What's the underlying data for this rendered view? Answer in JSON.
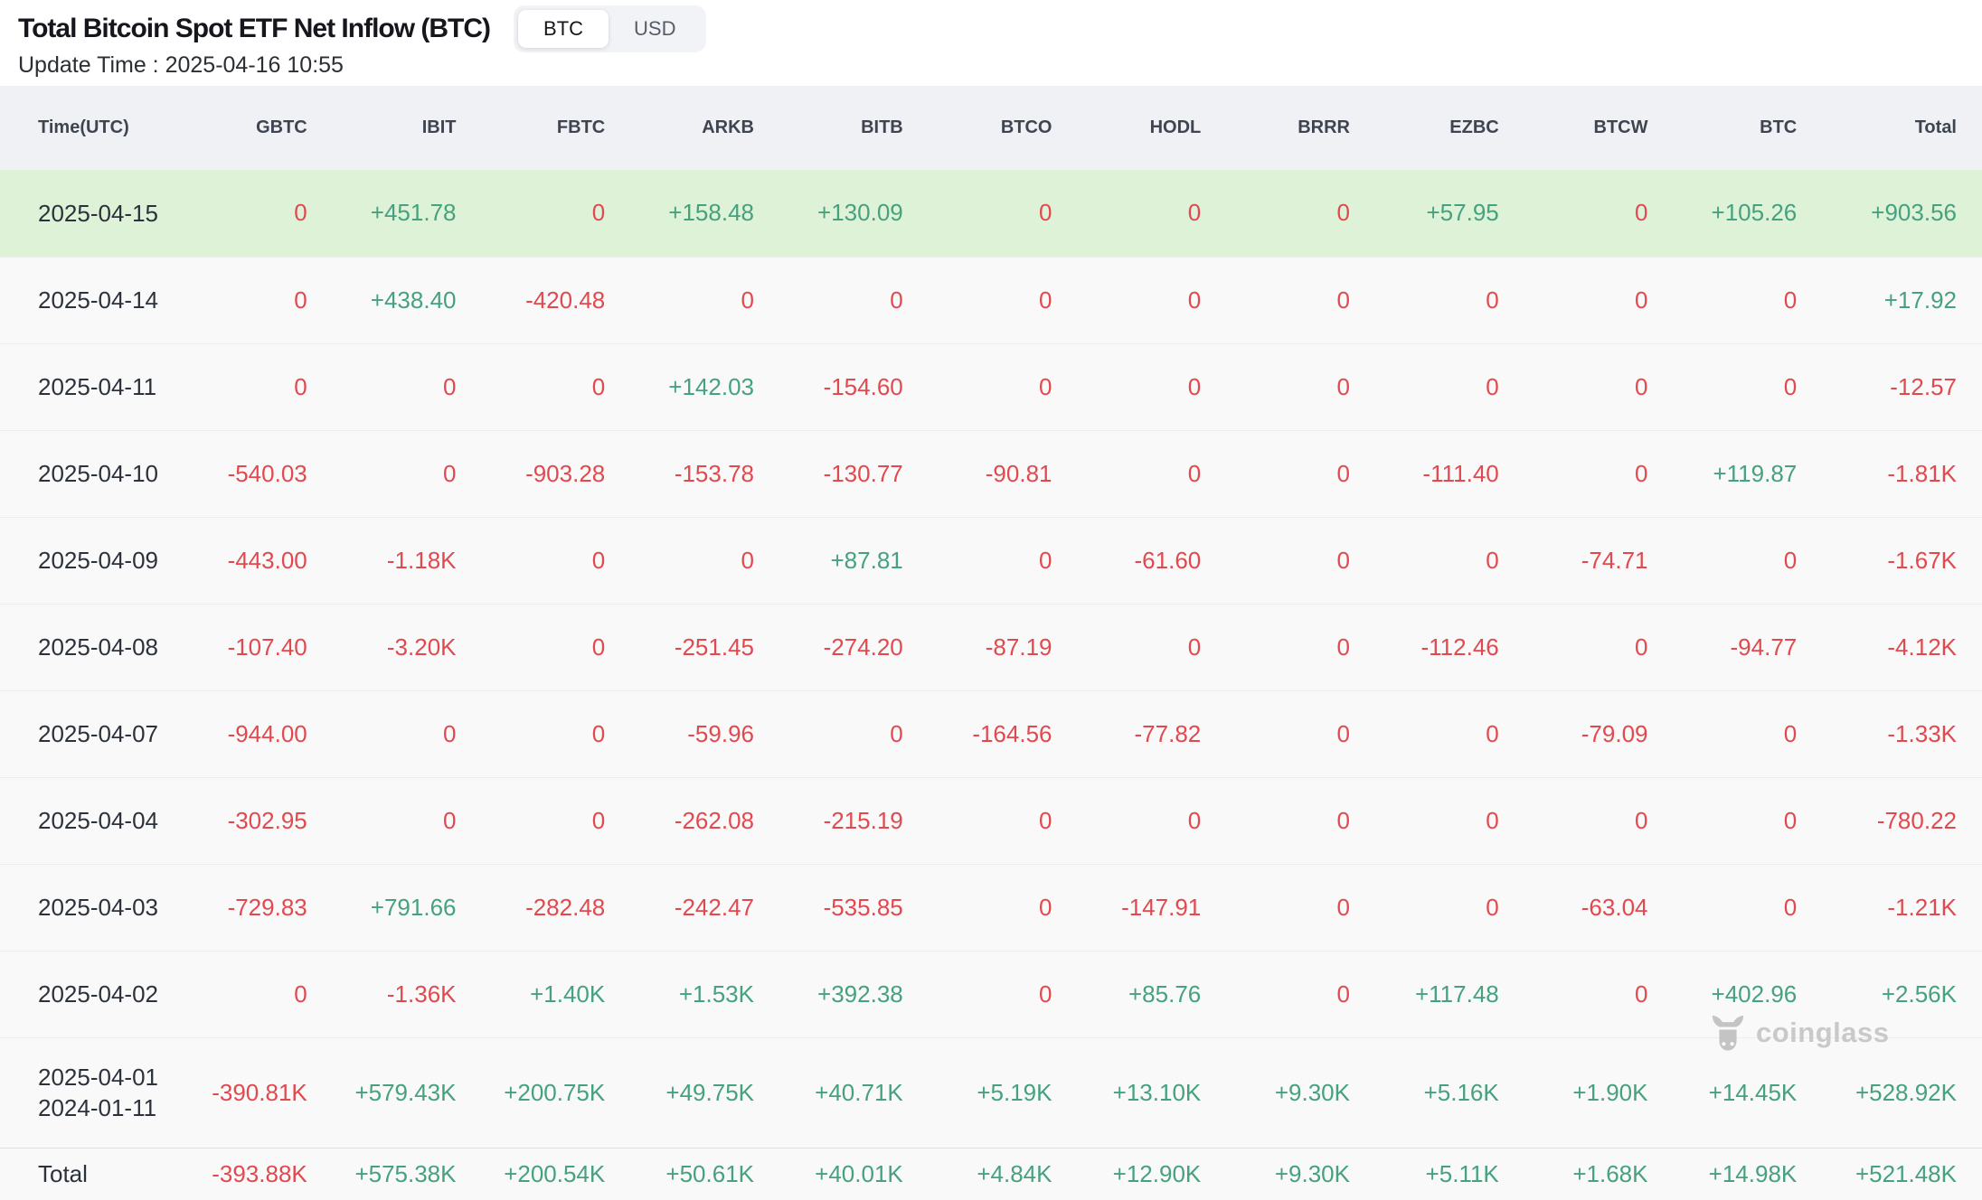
{
  "header": {
    "title": "Total Bitcoin Spot ETF Net Inflow (BTC)",
    "toggle": {
      "options": [
        "BTC",
        "USD"
      ],
      "selected": "BTC"
    },
    "update_time": "Update Time : 2025-04-16 10:55"
  },
  "colors": {
    "positive": "#45a17e",
    "negative": "#e2494f",
    "header_bg": "#f0f1f5",
    "row_bg": "#f9f9f9",
    "highlight_row_bg": "#def2d8"
  },
  "watermark": {
    "icon": "coinglass-bull-icon",
    "text": "coinglass"
  },
  "table": {
    "columns": [
      "Time(UTC)",
      "GBTC",
      "IBIT",
      "FBTC",
      "ARKB",
      "BITB",
      "BTCO",
      "HODL",
      "BRRR",
      "EZBC",
      "BTCW",
      "BTC",
      "Total"
    ],
    "rows": [
      {
        "time": [
          "2025-04-15"
        ],
        "highlight": true,
        "values": [
          "0",
          "+451.78",
          "0",
          "+158.48",
          "+130.09",
          "0",
          "0",
          "0",
          "+57.95",
          "0",
          "+105.26",
          "+903.56"
        ]
      },
      {
        "time": [
          "2025-04-14"
        ],
        "values": [
          "0",
          "+438.40",
          "-420.48",
          "0",
          "0",
          "0",
          "0",
          "0",
          "0",
          "0",
          "0",
          "+17.92"
        ]
      },
      {
        "time": [
          "2025-04-11"
        ],
        "values": [
          "0",
          "0",
          "0",
          "+142.03",
          "-154.60",
          "0",
          "0",
          "0",
          "0",
          "0",
          "0",
          "-12.57"
        ]
      },
      {
        "time": [
          "2025-04-10"
        ],
        "values": [
          "-540.03",
          "0",
          "-903.28",
          "-153.78",
          "-130.77",
          "-90.81",
          "0",
          "0",
          "-111.40",
          "0",
          "+119.87",
          "-1.81K"
        ]
      },
      {
        "time": [
          "2025-04-09"
        ],
        "values": [
          "-443.00",
          "-1.18K",
          "0",
          "0",
          "+87.81",
          "0",
          "-61.60",
          "0",
          "0",
          "-74.71",
          "0",
          "-1.67K"
        ]
      },
      {
        "time": [
          "2025-04-08"
        ],
        "values": [
          "-107.40",
          "-3.20K",
          "0",
          "-251.45",
          "-274.20",
          "-87.19",
          "0",
          "0",
          "-112.46",
          "0",
          "-94.77",
          "-4.12K"
        ]
      },
      {
        "time": [
          "2025-04-07"
        ],
        "values": [
          "-944.00",
          "0",
          "0",
          "-59.96",
          "0",
          "-164.56",
          "-77.82",
          "0",
          "0",
          "-79.09",
          "0",
          "-1.33K"
        ]
      },
      {
        "time": [
          "2025-04-04"
        ],
        "values": [
          "-302.95",
          "0",
          "0",
          "-262.08",
          "-215.19",
          "0",
          "0",
          "0",
          "0",
          "0",
          "0",
          "-780.22"
        ]
      },
      {
        "time": [
          "2025-04-03"
        ],
        "values": [
          "-729.83",
          "+791.66",
          "-282.48",
          "-242.47",
          "-535.85",
          "0",
          "-147.91",
          "0",
          "0",
          "-63.04",
          "0",
          "-1.21K"
        ]
      },
      {
        "time": [
          "2025-04-02"
        ],
        "values": [
          "0",
          "-1.36K",
          "+1.40K",
          "+1.53K",
          "+392.38",
          "0",
          "+85.76",
          "0",
          "+117.48",
          "0",
          "+402.96",
          "+2.56K"
        ]
      },
      {
        "time": [
          "2025-04-01",
          "2024-01-11"
        ],
        "values": [
          "-390.81K",
          "+579.43K",
          "+200.75K",
          "+49.75K",
          "+40.71K",
          "+5.19K",
          "+13.10K",
          "+9.30K",
          "+5.16K",
          "+1.90K",
          "+14.45K",
          "+528.92K"
        ]
      },
      {
        "time": [
          "Total"
        ],
        "is_total": true,
        "values": [
          "-393.88K",
          "+575.38K",
          "+200.54K",
          "+50.61K",
          "+40.01K",
          "+4.84K",
          "+12.90K",
          "+9.30K",
          "+5.11K",
          "+1.68K",
          "+14.98K",
          "+521.48K"
        ]
      }
    ]
  }
}
